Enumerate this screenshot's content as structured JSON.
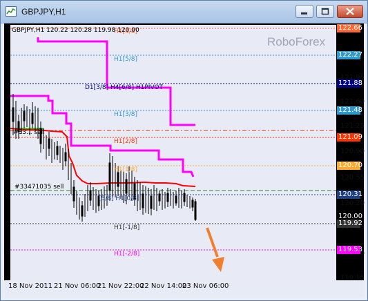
{
  "window": {
    "title": "GBPJPY,H1"
  },
  "chart": {
    "info": "GBPJPY,H1  120.22 120.28 119.98 120.00",
    "watermark": "RoboForex",
    "levels": {
      "h1_4_8": "H1[4/8]",
      "h1_5_8": "H1[5/8]",
      "pivot": "D1[3/8] H4[6/8] H1PIVOT",
      "h1_3_8": "H1[3/8]",
      "sell_1": "#33... sell",
      "h1_2_8": "H1[2/8]",
      "h1_1_8": "H1[1/8]",
      "sell_2": "#33471035 sell",
      "h1_0_8": "[5/8] H1[0/8]",
      "h1_m1_8": "H1[-1/8]",
      "h1_m2_8": "H1[-2/8]"
    },
    "y_axis": [
      "121.95",
      "121.60",
      "121.25",
      "120.90",
      "120.55",
      "120.20",
      "119.85",
      "119.50",
      "119.15"
    ],
    "x_axis": [
      "18 Nov 2011",
      "21 Nov 06:00",
      "21 Nov 22:00",
      "22 Nov 14:00",
      "23 Nov 06:00"
    ],
    "price_boxes": {
      "p1": "122.66",
      "p2": "122.27",
      "p3": "121.88",
      "p4": "121.48",
      "p5": "121.09",
      "p6": "120.70",
      "p7": "120.31",
      "p8": "120.00",
      "p9": "119.92",
      "p10": "119.53"
    },
    "colors": {
      "background": "#e8eaf6",
      "murrey_line": "#ff00ff",
      "ma_line": "#ff0000",
      "candles": "#000000",
      "arrow": "#f08030"
    }
  }
}
